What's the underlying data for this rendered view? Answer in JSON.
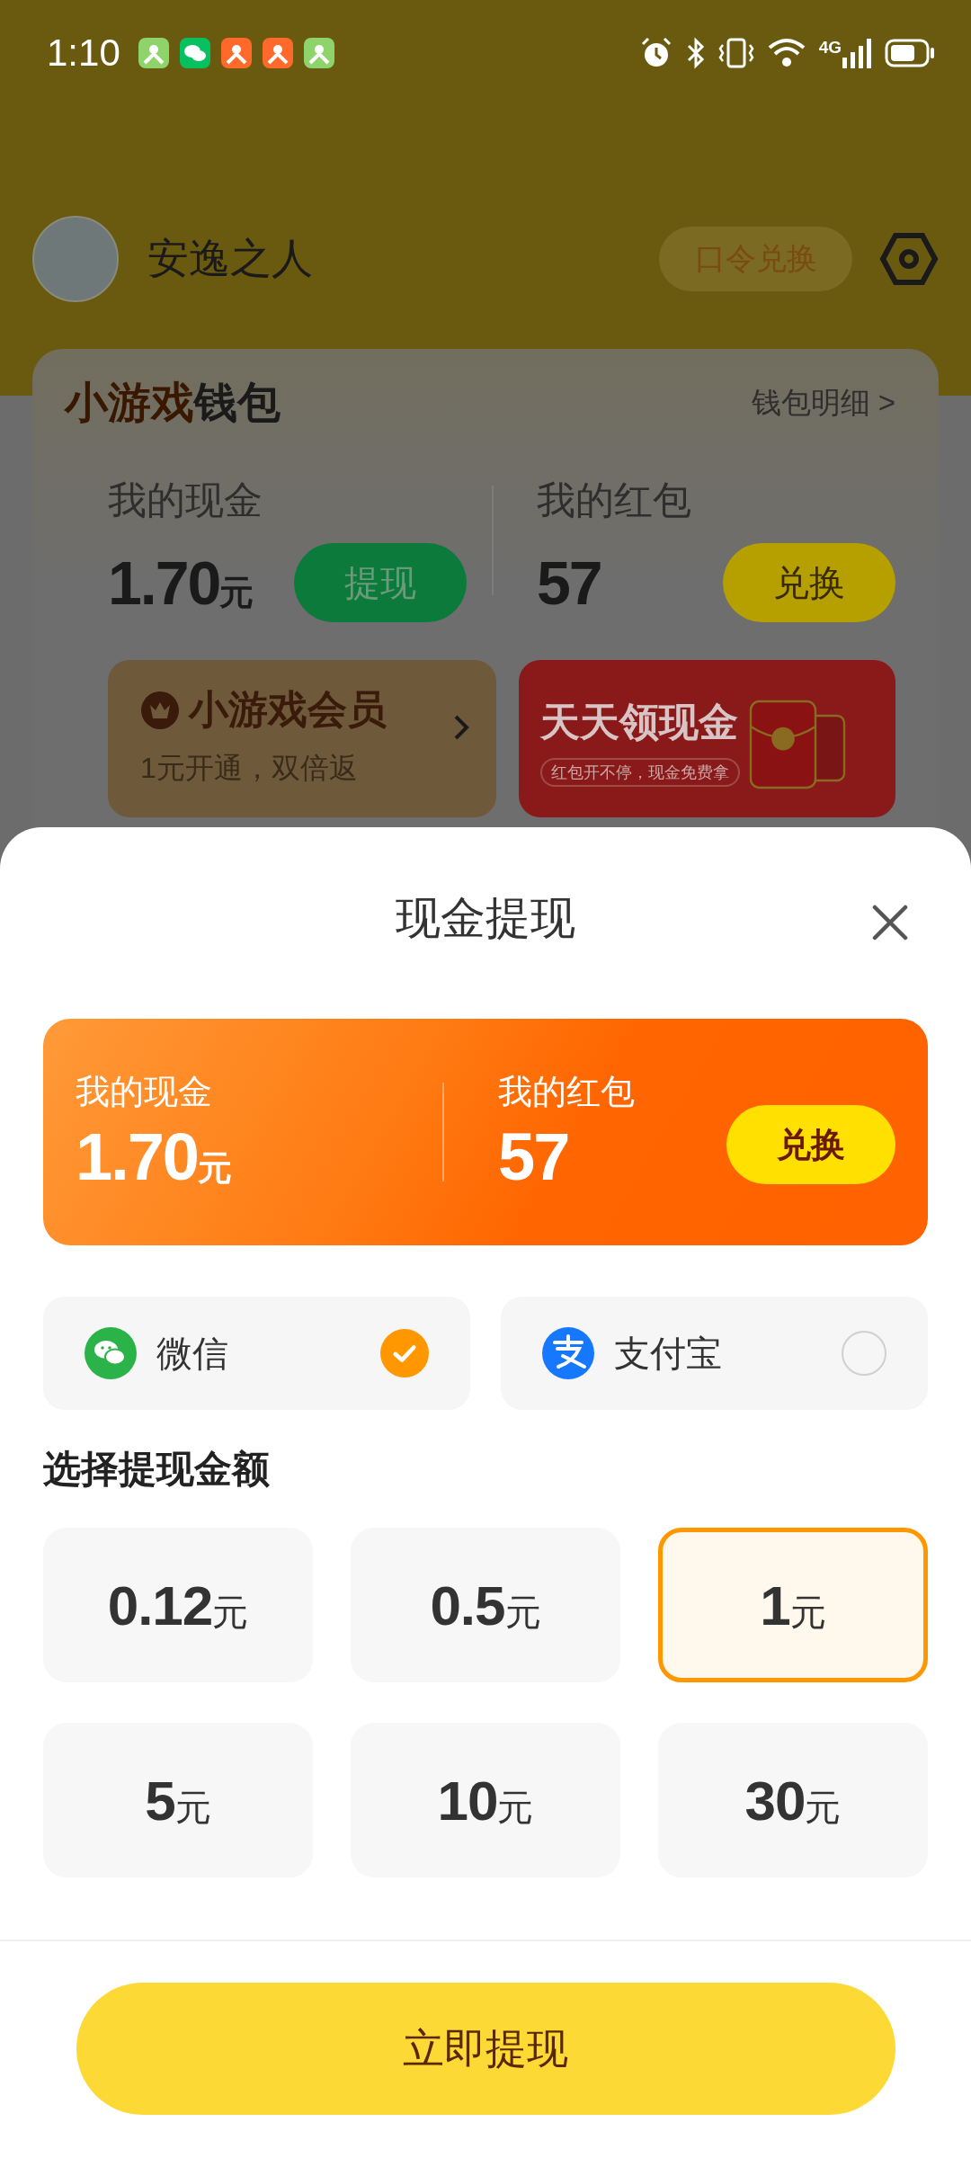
{
  "status_bar": {
    "time": "1:10",
    "network": "4G"
  },
  "profile": {
    "name": "安逸之人",
    "code_button": "口令兑换"
  },
  "wallet": {
    "title_accent": "小游戏",
    "title": "钱包",
    "detail_link": "钱包明细 >",
    "cash": {
      "label": "我的现金",
      "amount": "1.70",
      "unit": "元",
      "button": "提现"
    },
    "red_packet": {
      "label": "我的红包",
      "amount": "57",
      "button": "兑换"
    },
    "vip_card": {
      "title": "小游戏会员",
      "subtitle": "1元开通，双倍返"
    },
    "banner": {
      "title": "天天领现金",
      "subtitle": "红包开不停，现金免费拿"
    }
  },
  "sheet": {
    "title": "现金提现",
    "summary": {
      "cash_label": "我的现金",
      "cash_amount": "1.70",
      "unit": "元",
      "packet_label": "我的红包",
      "packet_amount": "57",
      "button": "兑换"
    },
    "methods": [
      {
        "kind": "wechat",
        "label": "微信",
        "selected": true
      },
      {
        "kind": "alipay",
        "label": "支付宝",
        "selected": false
      }
    ],
    "amount_heading": "选择提现金额",
    "amounts": [
      {
        "value": "0.12",
        "unit": "元",
        "selected": false
      },
      {
        "value": "0.5",
        "unit": "元",
        "selected": false
      },
      {
        "value": "1",
        "unit": "元",
        "selected": true
      },
      {
        "value": "5",
        "unit": "元",
        "selected": false
      },
      {
        "value": "10",
        "unit": "元",
        "selected": false
      },
      {
        "value": "30",
        "unit": "元",
        "selected": false
      }
    ],
    "submit": "立即提现"
  }
}
